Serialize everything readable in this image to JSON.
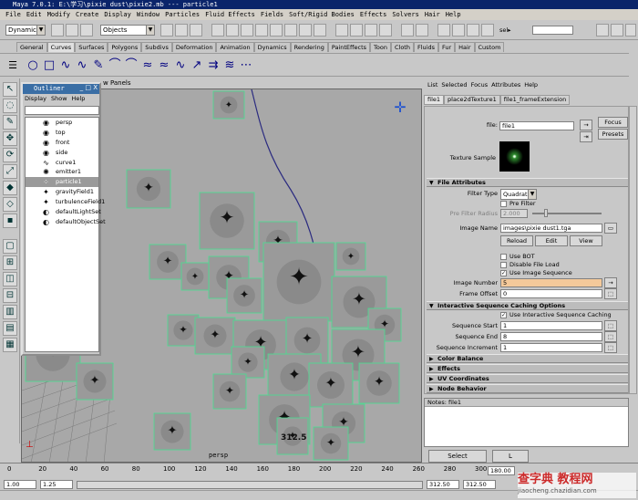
{
  "window": {
    "title": "Maya 7.0.1: E:\\学习\\pixie dust\\pixie2.mb  ---  particle1"
  },
  "menubar": [
    "File",
    "Edit",
    "Modify",
    "Create",
    "Display",
    "Window",
    "Particles",
    "Fluid Effects",
    "Fields",
    "Soft/Rigid Bodies",
    "Effects",
    "Solvers",
    "Hair",
    "Help"
  ],
  "statusline": {
    "menuset": "Dynamics",
    "selection_mask": "Objects",
    "sel_label": "sel▸"
  },
  "shelf_tabs": [
    "General",
    "Curves",
    "Surfaces",
    "Polygons",
    "Subdivs",
    "Deformation",
    "Animation",
    "Dynamics",
    "Rendering",
    "PaintEffects",
    "Toon",
    "Cloth",
    "Fluids",
    "Fur",
    "Hair",
    "Custom"
  ],
  "shelf_active": "Curves",
  "viewport": {
    "menu_partial": "w  Panels",
    "camera_label": "persp",
    "frame_label": "312.5"
  },
  "outliner": {
    "title": "Outliner",
    "menu": [
      "Display",
      "Show",
      "Help"
    ],
    "items": [
      {
        "label": "persp",
        "icon": "camera-icon"
      },
      {
        "label": "top",
        "icon": "camera-icon"
      },
      {
        "label": "front",
        "icon": "camera-icon"
      },
      {
        "label": "side",
        "icon": "camera-icon"
      },
      {
        "label": "curve1",
        "icon": "curve-icon"
      },
      {
        "label": "emitter1",
        "icon": "emitter-icon"
      },
      {
        "label": "particle1",
        "icon": "particle-icon",
        "selected": true
      },
      {
        "label": "gravityField1",
        "icon": "field-icon"
      },
      {
        "label": "turbulenceField1",
        "icon": "field-icon"
      },
      {
        "label": "defaultLightSet",
        "icon": "set-icon"
      },
      {
        "label": "defaultObjectSet",
        "icon": "set-icon"
      }
    ]
  },
  "attribute_editor": {
    "menu": [
      "List",
      "Selected",
      "Focus",
      "Attributes",
      "Help"
    ],
    "tabs": [
      "file1",
      "place2dTexture1",
      "file1_frameExtension"
    ],
    "node_label": "file:",
    "node_name": "file1",
    "focus_button": "Focus",
    "presets_button": "Presets",
    "texture_sample_label": "Texture Sample",
    "file_attributes": {
      "header": "File Attributes",
      "filter_type_label": "Filter Type",
      "filter_type_value": "Quadratic",
      "pre_filter_label": "Pre Filter",
      "pre_filter_radius_label": "Pre Filter Radius",
      "pre_filter_radius_value": "2.000",
      "image_name_label": "Image Name",
      "image_name_value": "images\\pixie dust1.tga",
      "reload": "Reload",
      "edit": "Edit",
      "view": "View",
      "use_bot": "Use BOT",
      "disable_file_load": "Disable File Load",
      "use_image_sequence": "Use Image Sequence",
      "image_number_label": "Image Number",
      "image_number_value": "5",
      "frame_offset_label": "Frame Offset",
      "frame_offset_value": "0"
    },
    "caching": {
      "header": "Interactive Sequence Caching Options",
      "use_caching": "Use Interactive Sequence Caching",
      "start_label": "Sequence Start",
      "start_value": "1",
      "end_label": "Sequence End",
      "end_value": "8",
      "inc_label": "Sequence Increment",
      "inc_value": "1"
    },
    "collapsed_sections": [
      "Color Balance",
      "Effects",
      "UV Coordinates",
      "Node Behavior"
    ],
    "notes_label": "Notes: file1",
    "select_button": "Select",
    "load_button": "L"
  },
  "timeline": {
    "ticks": [
      "0",
      "20",
      "40",
      "60",
      "80",
      "100",
      "120",
      "140",
      "160",
      "180",
      "200",
      "220",
      "240",
      "260",
      "280",
      "300"
    ],
    "end_field": "180.00"
  },
  "range": {
    "start": "1.00",
    "inner_start": "1.25",
    "end_a": "312.50",
    "end_b": "312.50"
  },
  "watermark": {
    "main": "查字典 教程网",
    "sub": "jiaocheng.chazidian.com"
  }
}
